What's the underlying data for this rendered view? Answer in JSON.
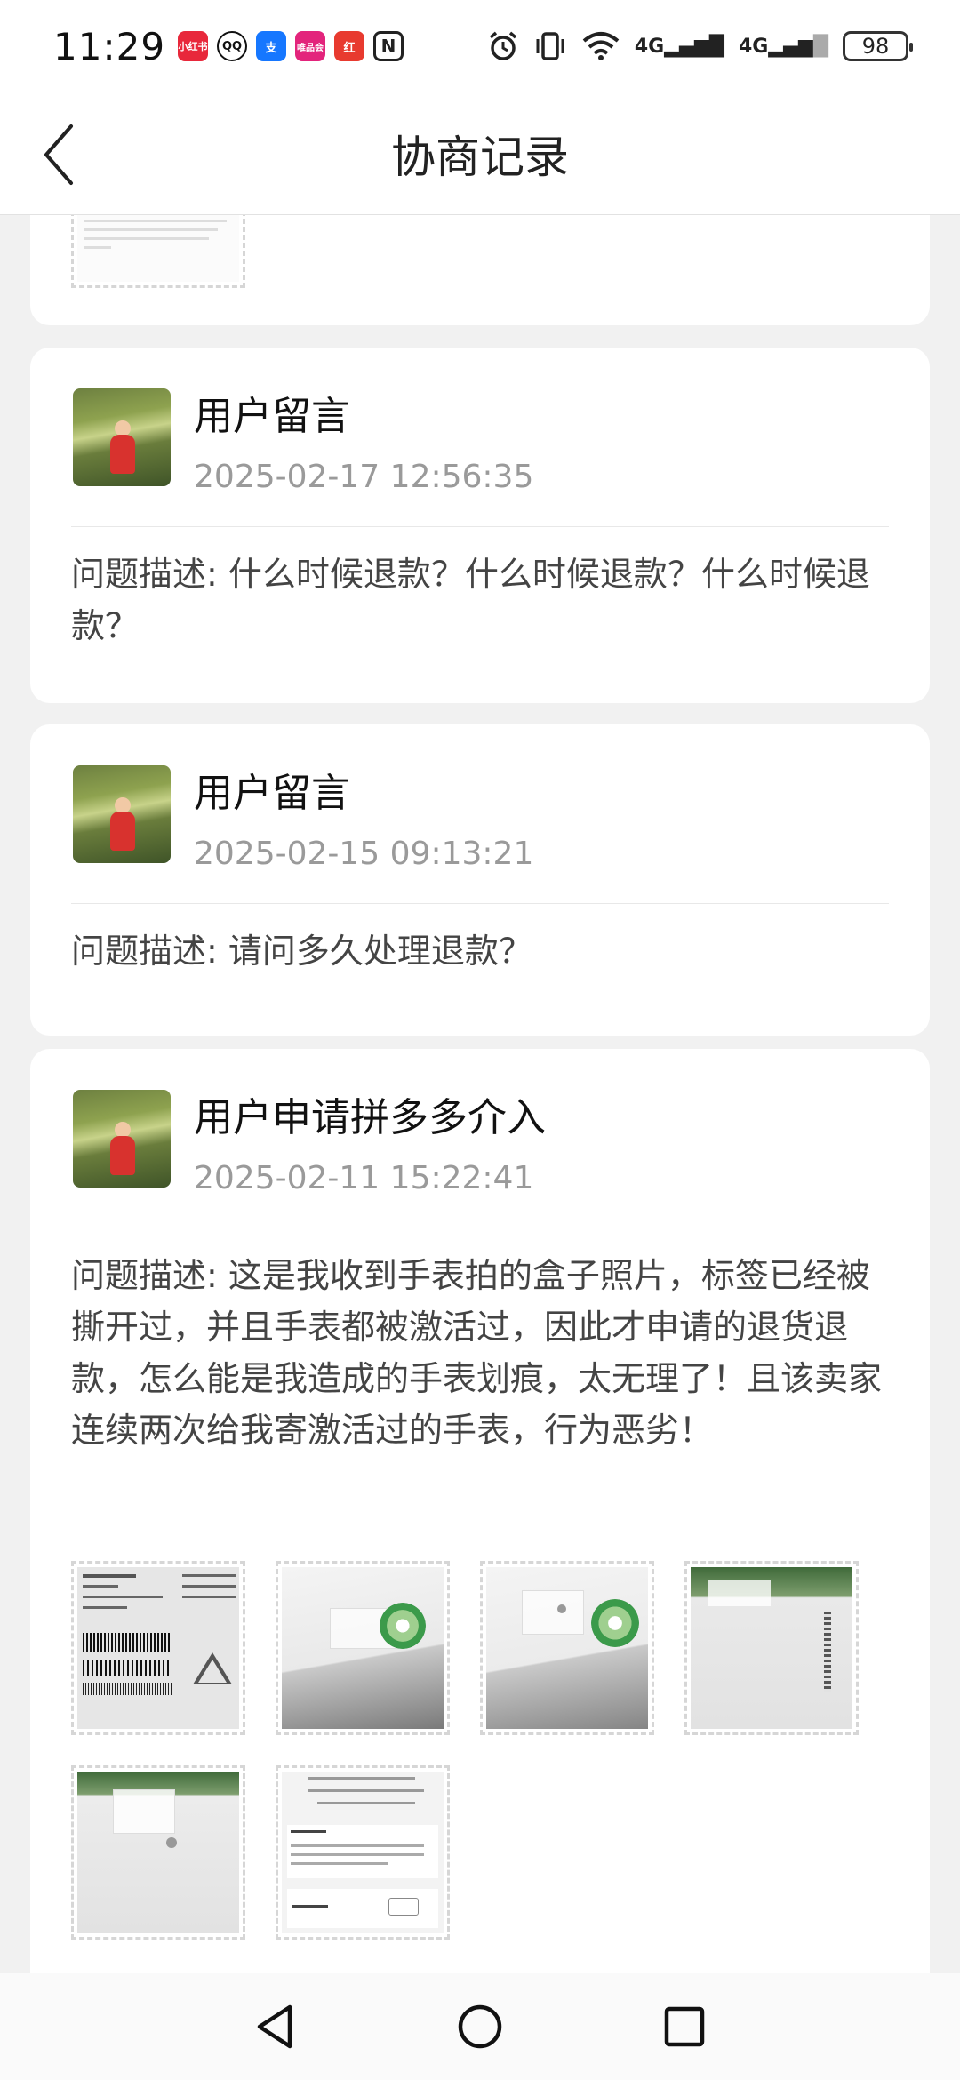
{
  "status_bar": {
    "time": "11:29",
    "app_icons": [
      {
        "name": "app-icon-red",
        "label": "小红书",
        "color": "#e8283b"
      },
      {
        "name": "qq-icon",
        "label": "QQ",
        "color": "#222222"
      },
      {
        "name": "alipay-icon",
        "label": "支",
        "color": "#1677ff"
      },
      {
        "name": "vip-icon",
        "label": "唯品会",
        "color": "#e3247c"
      },
      {
        "name": "app-icon-red2",
        "label": "红",
        "color": "#e83a2f"
      },
      {
        "name": "nfc-icon",
        "label": "N",
        "color": "#333333"
      }
    ],
    "network": "4G",
    "network2": "4G",
    "battery": "98"
  },
  "header": {
    "title": "协商记录",
    "back_icon": "chevron-left-icon"
  },
  "records": [
    {
      "title": "用户留言",
      "time": "2025-02-17 12:56:35",
      "description": "问题描述: 什么时候退款？什么时候退款？什么时候退款？"
    },
    {
      "title": "用户留言",
      "time": "2025-02-15 09:13:21",
      "description": "问题描述: 请问多久处理退款？"
    },
    {
      "title": "用户申请拼多多介入",
      "time": "2025-02-11 15:22:41",
      "description": "问题描述: 这是我收到手表拍的盒子照片，标签已经被撕开过，并且手表都被激活过，因此才申请的退货退款，怎么能是我造成的手表划痕，太无理了！且该卖家连续两次给我寄激活过的手表，行为恶劣！"
    }
  ],
  "photos": [
    {
      "name": "photo-box-label"
    },
    {
      "name": "photo-box-seal-1"
    },
    {
      "name": "photo-box-seal-2"
    },
    {
      "name": "photo-box-side"
    },
    {
      "name": "photo-box-sticker"
    },
    {
      "name": "photo-warranty-screenshot"
    }
  ],
  "system_nav": {
    "back": "triangle-back-icon",
    "home": "circle-home-icon",
    "recents": "square-recents-icon"
  }
}
